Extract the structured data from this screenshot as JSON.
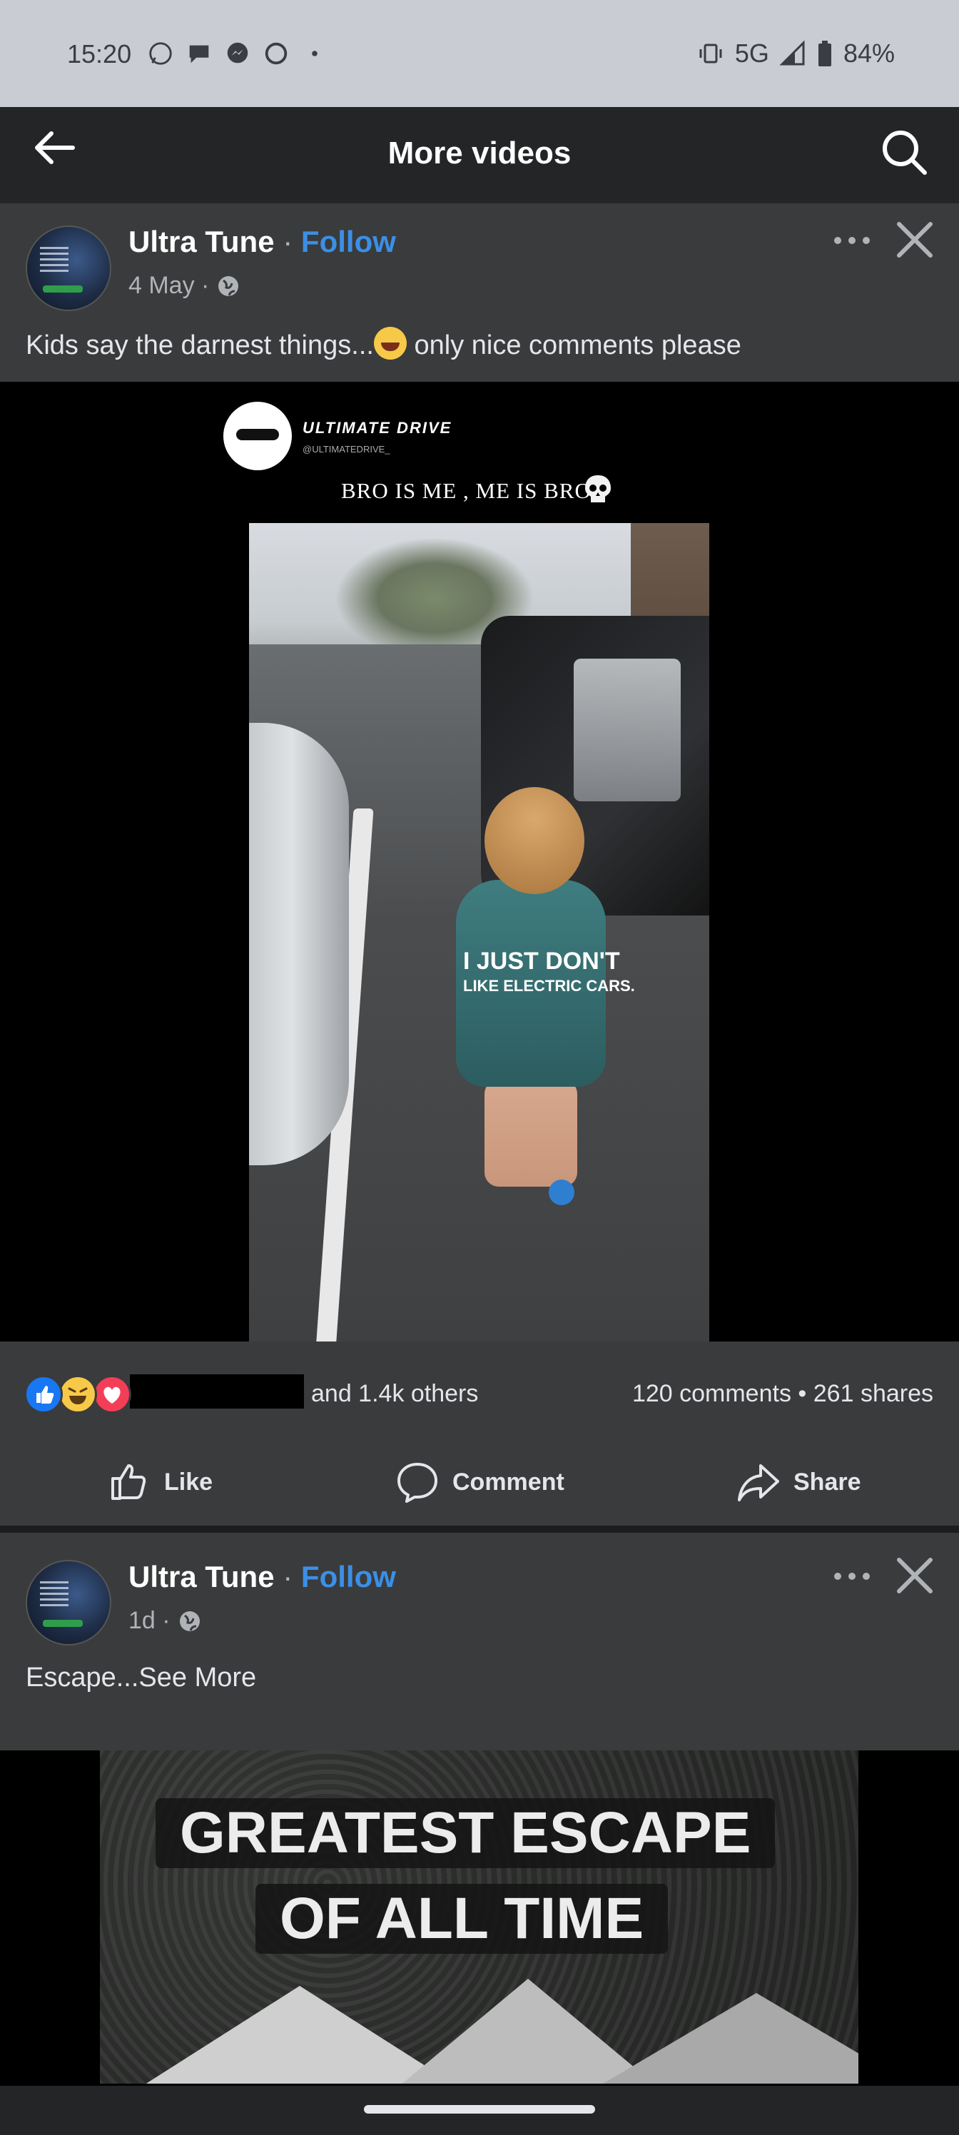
{
  "status_bar": {
    "time": "15:20",
    "network": "5G",
    "battery": "84%",
    "left_icons": [
      "whatsapp-icon",
      "chat-icon",
      "messenger-icon",
      "circle-icon",
      "dot-icon"
    ]
  },
  "header": {
    "title": "More videos"
  },
  "posts": [
    {
      "author": "Ultra Tune",
      "separator": "·",
      "follow_label": "Follow",
      "date": "4 May ·",
      "caption_before": "Kids say the darnest things...",
      "caption_after": " only nice comments please",
      "video": {
        "brand": "ULTIMATE DRIVE",
        "brand_handle": "@ULTIMATEDRIVE_",
        "overlay_title": "BRO IS ME , ME IS BRO",
        "shirt_line1": "I JUST DON'T",
        "shirt_line2": "LIKE ELECTRIC CARS."
      },
      "reactions": {
        "icons": [
          "like-reaction-icon",
          "haha-reaction-icon",
          "love-reaction-icon"
        ],
        "others": "and 1.4k others",
        "comments": "120 comments",
        "shares": "261 shares"
      },
      "actions": {
        "like": "Like",
        "comment": "Comment",
        "share": "Share"
      }
    },
    {
      "author": "Ultra Tune",
      "separator": "·",
      "follow_label": "Follow",
      "date": "1d ·",
      "caption": "Escape...",
      "see_more": "See More",
      "video": {
        "line1": "GREATEST ESCAPE",
        "line2": "OF ALL TIME"
      }
    }
  ],
  "colors": {
    "background": "#242526",
    "card": "#3a3b3c",
    "follow": "#3b8fe6",
    "like_blue": "#1877f2",
    "love_red": "#f33e58"
  }
}
